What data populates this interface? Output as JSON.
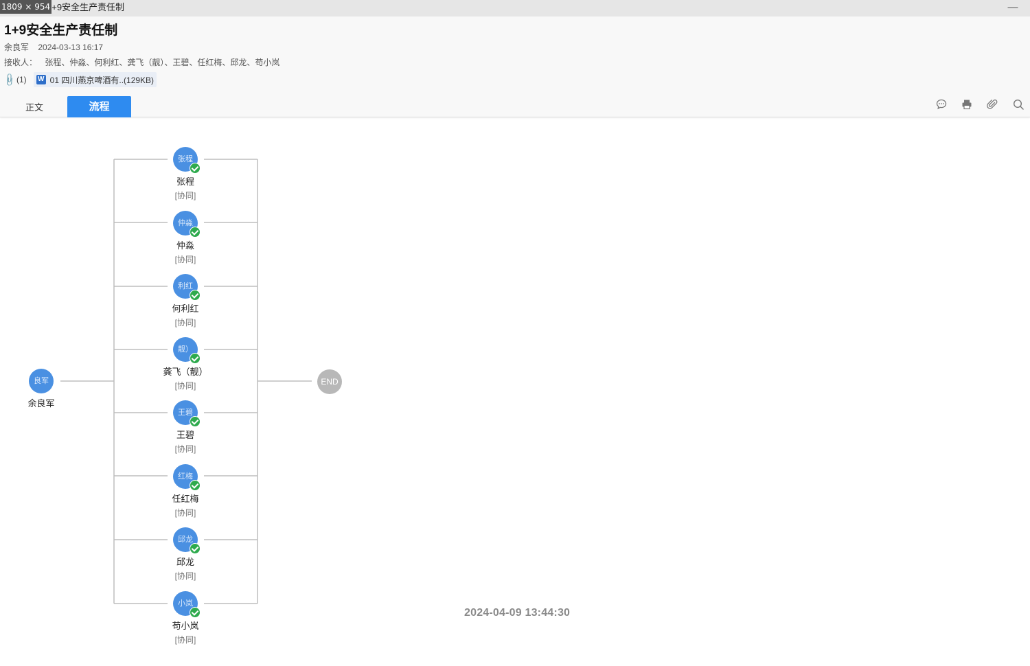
{
  "window": {
    "dimensions_badge": "1809 × 954",
    "title": "1+9安全生产责任制",
    "minimize": "—"
  },
  "document": {
    "title": "1+9安全生产责任制",
    "author": "余良军",
    "datetime": "2024-03-13 16:17",
    "recipients_label": "接收人：",
    "recipients": "张程、仲淼、何利红、龚飞（靓）、王碧、任红梅、邱龙、苟小岚",
    "attachment_count": "(1)",
    "attachment_name": "01 四川燕京啤酒有..(129KB)",
    "word_badge": "W"
  },
  "tabs": {
    "body": "正文",
    "flow": "流程"
  },
  "toolbar": [
    "comment-icon",
    "print-icon",
    "attachment-icon",
    "search-icon"
  ],
  "flow": {
    "start": {
      "avatar": "良军",
      "name": "余良军"
    },
    "nodes": [
      {
        "avatar": "张程",
        "name": "张程",
        "role": "[协同]"
      },
      {
        "avatar": "仲淼",
        "name": "仲淼",
        "role": "[协同]"
      },
      {
        "avatar": "利红",
        "name": "何利红",
        "role": "[协同]"
      },
      {
        "avatar": "靓）",
        "name": "龚飞（靓）",
        "role": "[协同]"
      },
      {
        "avatar": "王碧",
        "name": "王碧",
        "role": "[协同]"
      },
      {
        "avatar": "红梅",
        "name": "任红梅",
        "role": "[协同]"
      },
      {
        "avatar": "邱龙",
        "name": "邱龙",
        "role": "[协同]"
      },
      {
        "avatar": "小岚",
        "name": "苟小岚",
        "role": "[协同]"
      }
    ],
    "end_label": "END",
    "timestamp": "2024-04-09 13:44:30"
  }
}
